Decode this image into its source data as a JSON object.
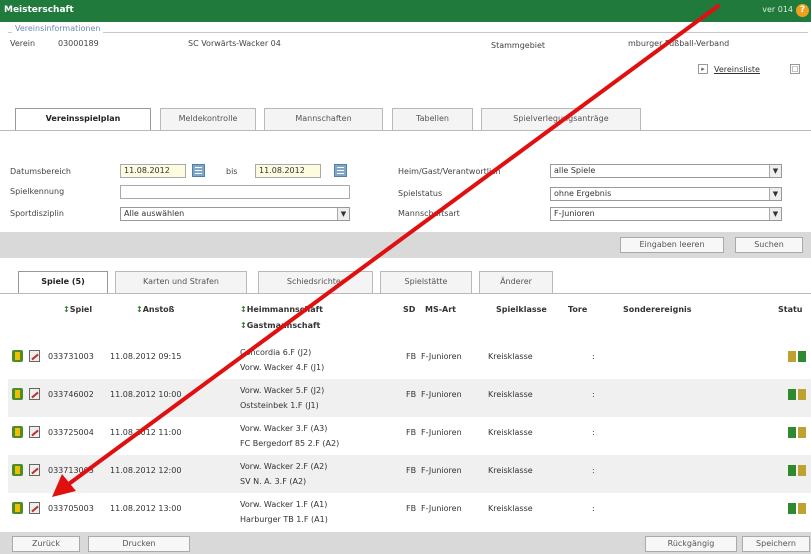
{
  "window": {
    "title": "Meisterschaft",
    "version": "ver 014",
    "help": "?"
  },
  "vereinsinfo": {
    "legend": "Vereinsinformationen",
    "verein_label": "Verein",
    "verein_nr": "03000189",
    "verein_name": "SC Vorwärts-Wacker 04",
    "stammgebiet_label": "Stammgebiet",
    "stammgebiet_value": "mburger Fußball-Verband",
    "vereinsliste": "Vereinsliste"
  },
  "main_tabs": [
    "Vereinsspielplan",
    "Meldekontrolle",
    "Mannschaften",
    "Tabellen",
    "Spielverlegungsanträge"
  ],
  "filters": {
    "datumsbereich_label": "Datumsbereich",
    "date_from": "11.08.2012",
    "bis": "bis",
    "date_to": "11.08.2012",
    "spielkennung_label": "Spielkennung",
    "spielkennung_value": "",
    "sportdisziplin_label": "Sportdisziplin",
    "sportdisziplin_value": "Alle auswählen",
    "heim_label": "Heim/Gast/Verantwortlich",
    "heim_value": "alle Spiele",
    "spielstatus_label": "Spielstatus",
    "spielstatus_value": "ohne Ergebnis",
    "msart_label": "Mannschaftsart",
    "msart_value": "F-Junioren"
  },
  "buttons": {
    "clear": "Eingaben leeren",
    "search": "Suchen",
    "back": "Zurück",
    "print": "Drucken",
    "undo": "Rückgängig",
    "save": "Speichern"
  },
  "sub_tabs": [
    "Spiele (5)",
    "Karten und Strafen",
    "Schiedsrichter",
    "Spielstätte",
    "Änderer"
  ],
  "table": {
    "headers": {
      "spiel": "Spiel",
      "anstoss": "Anstoß",
      "heim": "Heimmannschaft",
      "gast": "Gastmannschaft",
      "sd": "SD",
      "msart": "MS-Art",
      "spielklasse": "Spielklasse",
      "tore": "Tore",
      "sonder": "Sonderereignis",
      "status": "Statu"
    },
    "rows": [
      {
        "spiel": "033731003",
        "anstoss": "11.08.2012 09:15",
        "heim": "Concordia 6.F (J2)",
        "gast": "Vorw. Wacker 4.F (J1)",
        "sd": "FB",
        "msart": "F-Junioren",
        "spielklasse": "Kreisklasse",
        "tore": ":"
      },
      {
        "spiel": "033746002",
        "anstoss": "11.08.2012 10:00",
        "heim": "Vorw. Wacker 5.F (J2)",
        "gast": "Oststeinbek 1.F (J1)",
        "sd": "FB",
        "msart": "F-Junioren",
        "spielklasse": "Kreisklasse",
        "tore": ":"
      },
      {
        "spiel": "033725004",
        "anstoss": "11.08.2012 11:00",
        "heim": "Vorw. Wacker 3.F (A3)",
        "gast": "FC Bergedorf 85 2.F (A2)",
        "sd": "FB",
        "msart": "F-Junioren",
        "spielklasse": "Kreisklasse",
        "tore": ":"
      },
      {
        "spiel": "033713003",
        "anstoss": "11.08.2012 12:00",
        "heim": "Vorw. Wacker 2.F (A2)",
        "gast": "SV N. A. 3.F (A2)",
        "sd": "FB",
        "msart": "F-Junioren",
        "spielklasse": "Kreisklasse",
        "tore": ":"
      },
      {
        "spiel": "033705003",
        "anstoss": "11.08.2012 13:00",
        "heim": "Vorw. Wacker 1.F (A1)",
        "gast": "Harburger TB 1.F (A1)",
        "sd": "FB",
        "msart": "F-Junioren",
        "spielklasse": "Kreisklasse",
        "tore": ":"
      }
    ]
  },
  "annotation_color": "#e01010"
}
